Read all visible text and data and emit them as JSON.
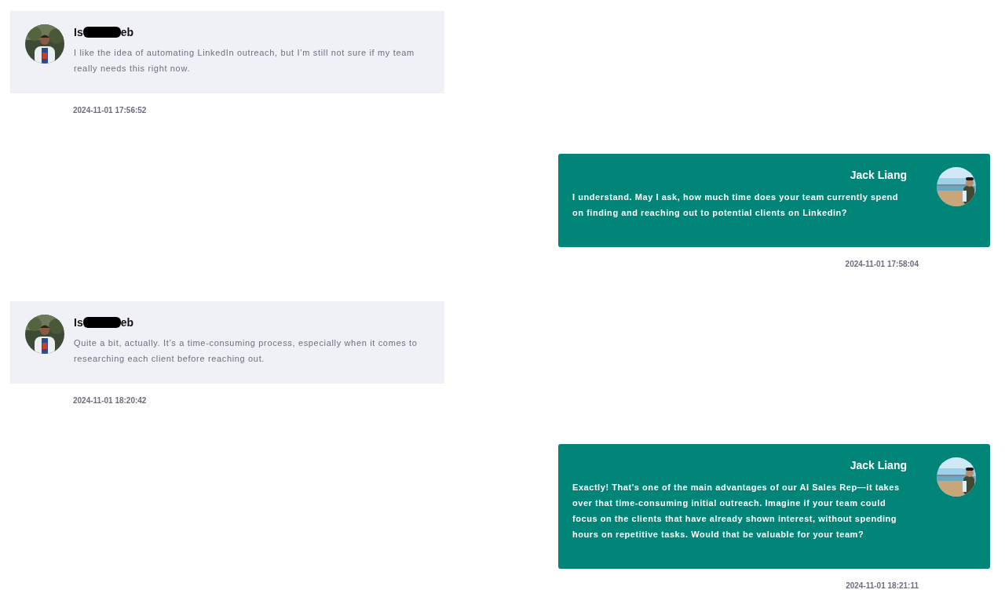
{
  "messages": [
    {
      "kind": "left",
      "sender": {
        "name_start": "Is",
        "name_end": "eb",
        "redacted": true
      },
      "text": "I like the idea of automating LinkedIn outreach, but I’m still not sure if my team really needs this right now.",
      "time": "2024-11-01 17:56:52"
    },
    {
      "kind": "right",
      "sender": {
        "name": "Jack Liang"
      },
      "text": "I understand. May I ask, how much time does your team currently spend on finding and reaching out to potential clients on Linkedin?",
      "time": "2024-11-01 17:58:04"
    },
    {
      "kind": "left",
      "sender": {
        "name_start": "Is",
        "name_end": "eb",
        "redacted": true
      },
      "text": "Quite a bit, actually. It’s a time-consuming process, especially when it comes to researching each client before reaching out.",
      "time": "2024-11-01 18:20:42"
    },
    {
      "kind": "right",
      "sender": {
        "name": "Jack Liang"
      },
      "text": "Exactly! That’s one of the main advantages of our AI Sales Rep—it takes over that time-consuming initial outreach. Imagine if your team could focus on the clients that have already shown interest, without spending  hours on repetitive tasks. Would that be valuable for your team?",
      "time": "2024-11-01 18:21:11"
    }
  ]
}
